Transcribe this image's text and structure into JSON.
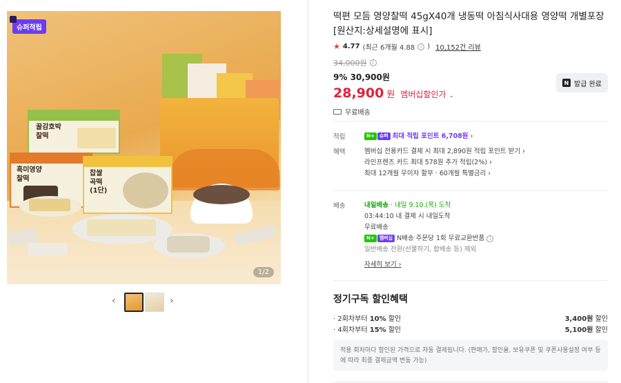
{
  "gallery": {
    "badge": "슈퍼적립",
    "counter": "1/2",
    "packages": {
      "pkg1": "꿀감호박\n찰떡",
      "pkg2": "흑미영양\n찰떡",
      "pkg3": "찹쌀\n곡떡\n(1단)"
    },
    "prev_arrow": "‹",
    "next_arrow": "›"
  },
  "product": {
    "title": "떡편 모듬 영양찰떡 45gX40개 냉동떡 아침식사대용 영양떡 개별포장 [원산지:상세설명에 표시]",
    "rating": {
      "score": "4.77",
      "recent": "(최근 6개월 4.88",
      "recent_close": ")",
      "reviews": "10,152건 리뷰"
    },
    "price": {
      "original": "34,000원",
      "discount_pct": "9%",
      "sale": "30,900원",
      "member_amount": "28,900",
      "member_won": "원",
      "member_label": "멤버십할인가",
      "chevron": "⌄"
    },
    "coupon_button": {
      "icon_letter": "N",
      "label": "발급 완료"
    },
    "shipping_free": "무료배송"
  },
  "points": {
    "label": "적립",
    "badge_n": "N+",
    "badge_super": "슈퍼",
    "text": "최대 적립 포인트 6,708원",
    "chev": "›"
  },
  "benefits": {
    "label": "혜택",
    "lines": [
      "멤버십 전용카드 결제 시 최대 2,890원 적립 포인트 받기 ›",
      "라인프렌즈 카드 최대 578원 추가 적립(2%) ›",
      "최대 12개월 무이자 할부 · 60개월 특별금리 ›"
    ]
  },
  "delivery": {
    "label": "배송",
    "badge": "내일배송",
    "arrival": "· 내일 9.10.(목) 도착",
    "countdown": "03:44:10  내 결제 시 내일도착",
    "fee": "무료배송",
    "return_badge_n": "N+",
    "return_badge_2": "멤버십",
    "return_text": "N배송 주문당 1회 무료교환반품",
    "exclude": "일반배송 전환(선물하기, 합배송 등) 제외",
    "more": "자세히 보기 ›"
  },
  "subscription": {
    "title": "정기구독 할인혜택",
    "rows": [
      {
        "left_prefix": "· 2회차부터 ",
        "left_bold": "10%",
        "left_suffix": " 할인",
        "right_bold": "3,400원",
        "right_suffix": " 할인"
      },
      {
        "left_prefix": "· 4회차부터 ",
        "left_bold": "15%",
        "left_suffix": " 할인",
        "right_bold": "5,100원",
        "right_suffix": " 할인"
      }
    ],
    "note": "적용 회차마다 할인된 가격으로 자동 결제됩니다. (판매가, 할인율, 보유쿠폰 및 쿠폰사용설정 여부 등에 따라 최종 결제금액 변동 가능)"
  },
  "colors": {
    "accent_red": "#e0213b",
    "naver_green": "#1ec800",
    "super_purple": "#6b3df2"
  }
}
